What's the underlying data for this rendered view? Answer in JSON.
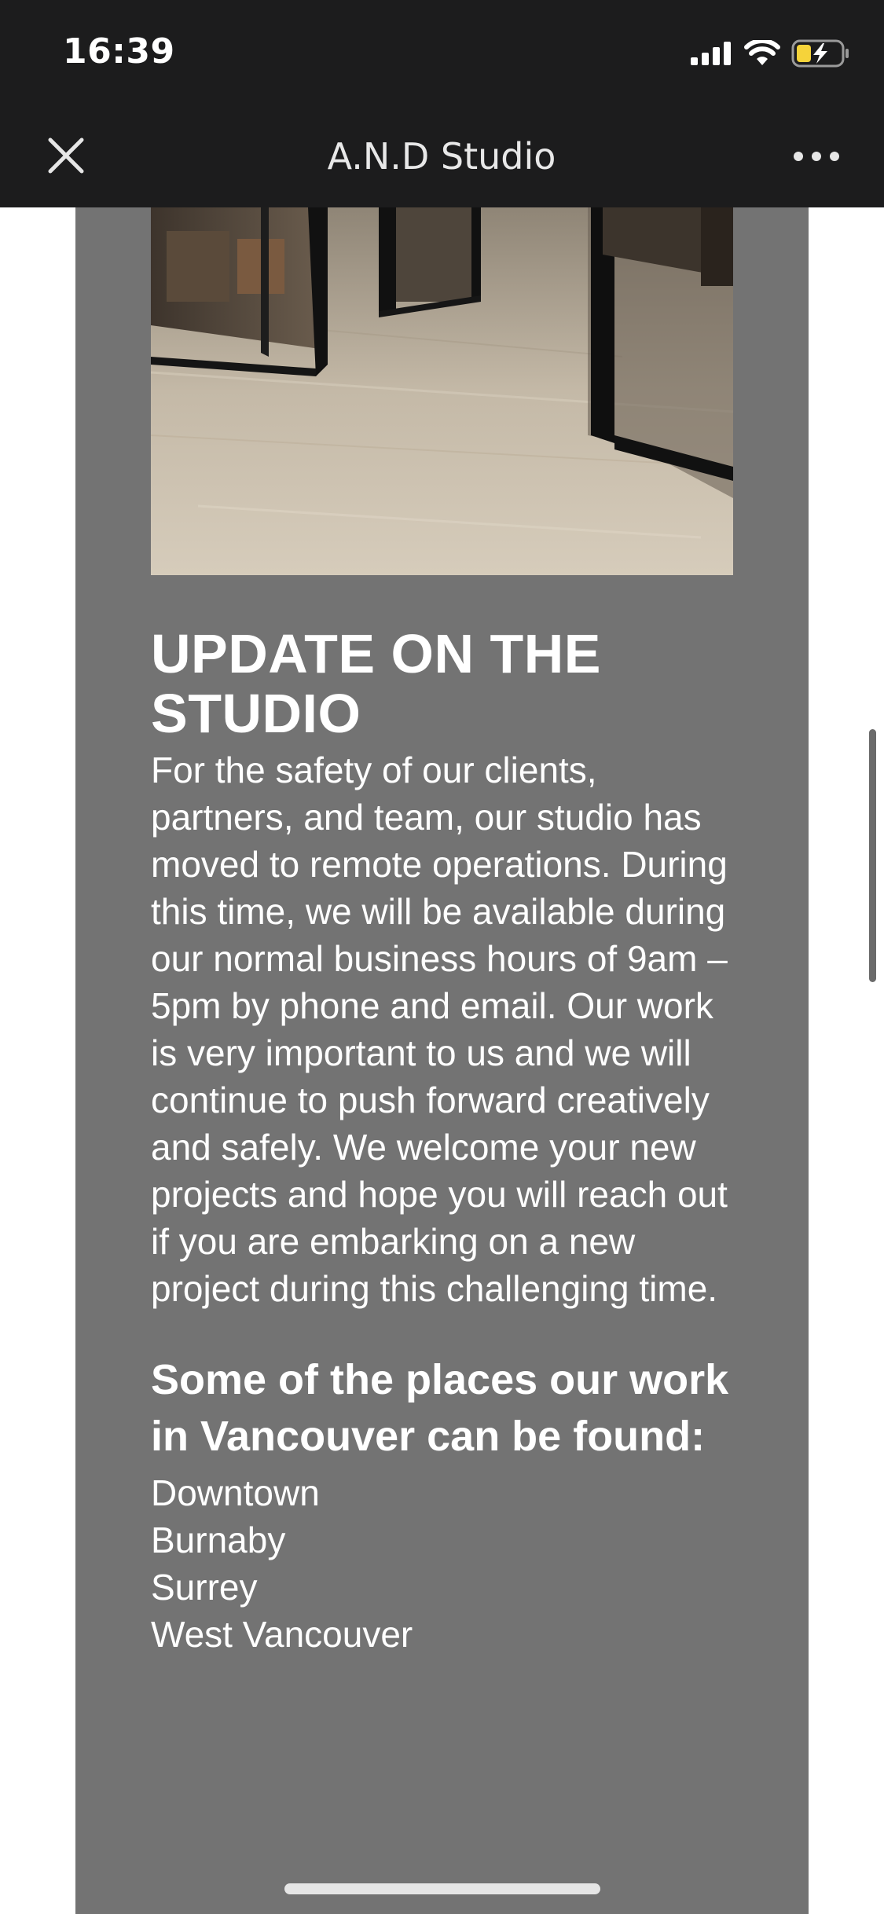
{
  "status_bar": {
    "time": "16:39",
    "icons": [
      "cellular-signal-icon",
      "wifi-icon",
      "battery-charging-icon"
    ],
    "battery_color": "#f5d33a"
  },
  "nav": {
    "title": "A.N.D Studio",
    "close_icon": "close-icon",
    "more_icon": "more-icon"
  },
  "article": {
    "heading_lines": [
      "UPDATE ON THE",
      "STUDIO"
    ],
    "body": "For the safety of our clients, partners, and team, our studio has moved to remote operations. During this time, we will be available during our normal business hours of 9am – 5pm by phone and email. Our work is very important to us and we will continue to push forward creatively and safely. We welcome your new projects and hope you will reach out if you are embarking on a new project during this challenging time.",
    "places_heading": "Some of the places our work in Vancouver can be found:",
    "places": [
      "Downtown",
      "Burnaby",
      "Surrey",
      "West Vancouver"
    ]
  },
  "colors": {
    "bar_background": "#1c1c1d",
    "card_background": "#737373",
    "text": "#ffffff"
  }
}
